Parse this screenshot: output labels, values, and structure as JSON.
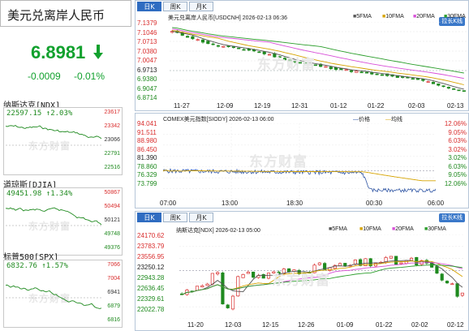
{
  "quote": {
    "title": "美元兑离岸人民币",
    "price": "6.8981",
    "change": "-0.0009",
    "change_pct": "-0.01%",
    "color": "#12a12e"
  },
  "mini_charts": [
    {
      "name": "纳斯达克[NDX]",
      "value": "22597.15",
      "pct": "2.03%",
      "axis": [
        "23617",
        "23342",
        "23066",
        "22791",
        "22516"
      ]
    },
    {
      "name": "道琼斯[DJIA]",
      "value": "49451.98",
      "pct": "1.34%",
      "axis": [
        "50867",
        "50494",
        "50121",
        "49748",
        "49376"
      ]
    },
    {
      "name": "标普500[SPX]",
      "value": "6832.76",
      "pct": "1.57%",
      "axis": [
        "7066",
        "7004",
        "6941",
        "6879",
        "6816"
      ]
    }
  ],
  "watermark": "东方财富",
  "chart1": {
    "tabs": [
      "日K",
      "周K",
      "月K"
    ],
    "stretch_label": "拉长K线",
    "header": "美元兑离岸人民币[USDCNH] 2026-02-13 06:36",
    "legend": [
      "5FMA",
      "10FMA",
      "20FMA",
      "30FMA"
    ],
    "yticks": [
      "7.1379",
      "7.1046",
      "7.0713",
      "7.0380",
      "7.0047",
      "6.9713",
      "6.9380",
      "6.9047",
      "6.8714"
    ],
    "xticks": [
      "11-27",
      "12-09",
      "12-19",
      "12-31",
      "01-12",
      "01-22",
      "02-03",
      "02-13"
    ]
  },
  "chart2": {
    "header": "COMEX美元指数[SIODY] 2026-02-13 06:00",
    "legend_price": "价格",
    "legend_avg": "均线",
    "yticks_left": [
      "94.041",
      "91.511",
      "88.980",
      "86.450",
      "81.390",
      "78.860",
      "76.329",
      "73.799"
    ],
    "yticks_right": [
      "12.06%",
      "9.05%",
      "6.03%",
      "3.02%",
      "3.02%",
      "6.03%",
      "9.05%",
      "12.06%"
    ],
    "xticks": [
      "07:00",
      "13:00",
      "18:30",
      "00:30",
      "06:00"
    ]
  },
  "chart3": {
    "tabs": [
      "日K",
      "周K",
      "月K"
    ],
    "stretch_label": "拉长K线",
    "header": "纳斯达克[NDX] 2026-02-13 05:00",
    "legend": [
      "5FMA",
      "10FMA",
      "20FMA",
      "30FMA"
    ],
    "yticks": [
      "24170.62",
      "23783.79",
      "23556.95",
      "23250.12",
      "22943.28",
      "22636.45",
      "22329.61",
      "22022.78"
    ],
    "xticks": [
      "11-20",
      "12-03",
      "12-15",
      "12-26",
      "01-09",
      "01-22",
      "02-02",
      "02-12"
    ]
  },
  "chart_data": [
    {
      "type": "line",
      "title": "美元兑离岸人民币[USDCNH]",
      "x": [
        "11-27",
        "12-09",
        "12-19",
        "12-31",
        "01-12",
        "01-22",
        "02-03",
        "02-13"
      ],
      "series": [
        {
          "name": "USDCNH",
          "values": [
            7.1046,
            7.058,
            7.038,
            6.999,
            6.976,
            6.956,
            6.938,
            6.8981
          ]
        }
      ],
      "ylim": [
        6.8714,
        7.1379
      ]
    },
    {
      "type": "line",
      "title": "COMEX美元指数[SIODY]",
      "x": [
        "07:00",
        "13:00",
        "18:30",
        "00:30",
        "06:00"
      ],
      "series": [
        {
          "name": "价格",
          "values": [
            81.4,
            81.3,
            80.9,
            76.3,
            76.2
          ]
        },
        {
          "name": "均线",
          "values": [
            81.4,
            81.3,
            81.1,
            79.2,
            78.9
          ]
        }
      ],
      "ylim": [
        73.799,
        94.041
      ]
    },
    {
      "type": "line",
      "title": "纳斯达克[NDX]",
      "x": [
        "11-20",
        "12-03",
        "12-15",
        "12-26",
        "01-09",
        "01-22",
        "02-02",
        "02-12"
      ],
      "series": [
        {
          "name": "NDX",
          "values": [
            22650,
            23250,
            23100,
            23300,
            23350,
            23500,
            23450,
            22597
          ]
        }
      ],
      "ylim": [
        22022.78,
        24170.62
      ]
    }
  ]
}
